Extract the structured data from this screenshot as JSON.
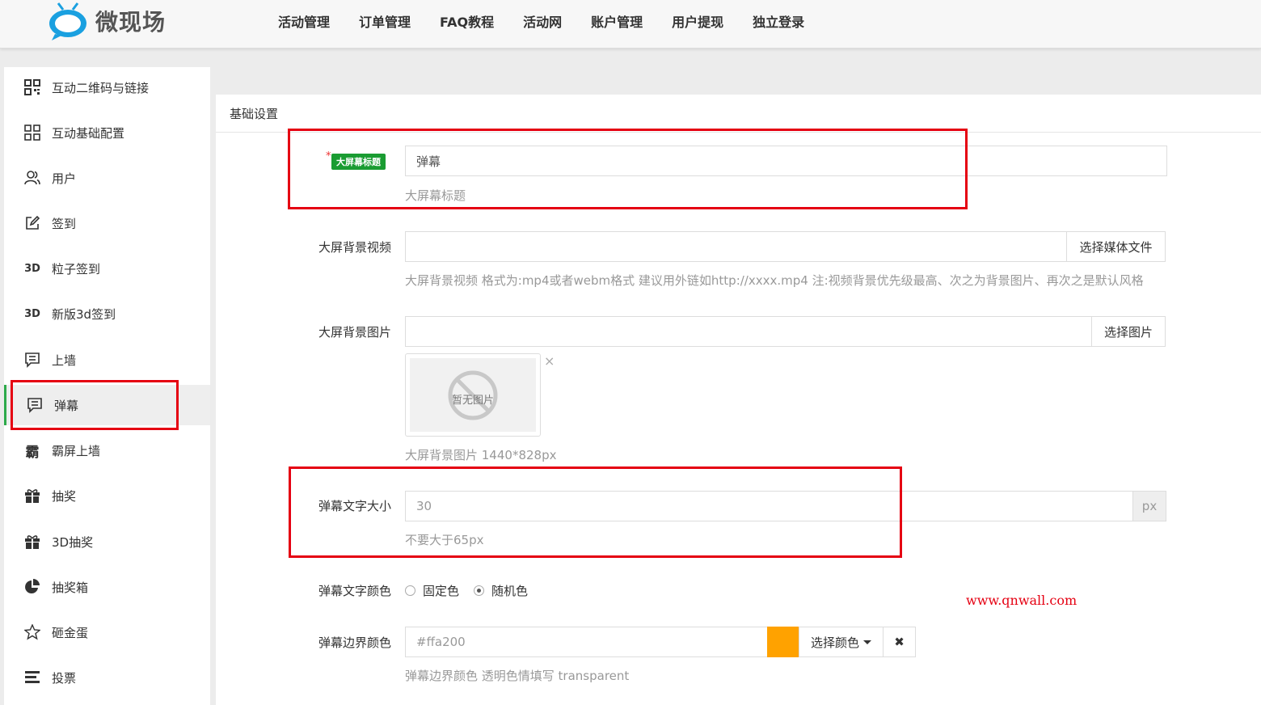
{
  "header": {
    "logo_text": "微现场",
    "nav": [
      "活动管理",
      "订单管理",
      "FAQ教程",
      "活动网",
      "账户管理",
      "用户提现",
      "独立登录"
    ]
  },
  "sidebar": {
    "items": [
      {
        "label": "互动二维码与链接",
        "icon": "qrcode-icon"
      },
      {
        "label": "互动基础配置",
        "icon": "grid-icon"
      },
      {
        "label": "用户",
        "icon": "users-icon"
      },
      {
        "label": "签到",
        "icon": "edit-icon"
      },
      {
        "label": "粒子签到",
        "icon": "3d-icon"
      },
      {
        "label": "新版3d签到",
        "icon": "3d-icon"
      },
      {
        "label": "上墙",
        "icon": "message-icon"
      },
      {
        "label": "弹幕",
        "icon": "message-icon",
        "active": true
      },
      {
        "label": "霸屏上墙",
        "icon": "ba-icon"
      },
      {
        "label": "抽奖",
        "icon": "gift-icon"
      },
      {
        "label": "3D抽奖",
        "icon": "gift-icon"
      },
      {
        "label": "抽奖箱",
        "icon": "pie-icon"
      },
      {
        "label": "砸金蛋",
        "icon": "star-icon"
      },
      {
        "label": "投票",
        "icon": "list-icon"
      }
    ]
  },
  "panel": {
    "title": "基础设置",
    "fields": {
      "title": {
        "badge": "大屏幕标题",
        "required_mark": "*",
        "value": "弹幕",
        "help": "大屏幕标题"
      },
      "video": {
        "label": "大屏背景视频",
        "value": "",
        "button": "选择媒体文件",
        "help": "大屏背景视频 格式为:mp4或者webm格式 建议用外链如http://xxxx.mp4 注:视频背景优先级最高、次之为背景图片、再次之是默认风格"
      },
      "image": {
        "label": "大屏背景图片",
        "value": "",
        "button": "选择图片",
        "placeholder_text": "暂无图片",
        "close": "×",
        "help": "大屏背景图片 1440*828px"
      },
      "font_size": {
        "label": "弹幕文字大小",
        "value": "30",
        "unit": "px",
        "help": "不要大于65px"
      },
      "font_color": {
        "label": "弹幕文字颜色",
        "options": [
          "固定色",
          "随机色"
        ],
        "selected": "随机色"
      },
      "border_color": {
        "label": "弹幕边界颜色",
        "value": "#ffa200",
        "swatch_color": "#ffa200",
        "button": "选择颜色",
        "clear": "✖",
        "help": "弹幕边界颜色 透明色情填写 transparent"
      }
    }
  },
  "watermark": "www.qnwall.com",
  "colors": {
    "accent": "#2eaa4b",
    "highlight": "#e50012",
    "badge": "#1a9c32"
  }
}
